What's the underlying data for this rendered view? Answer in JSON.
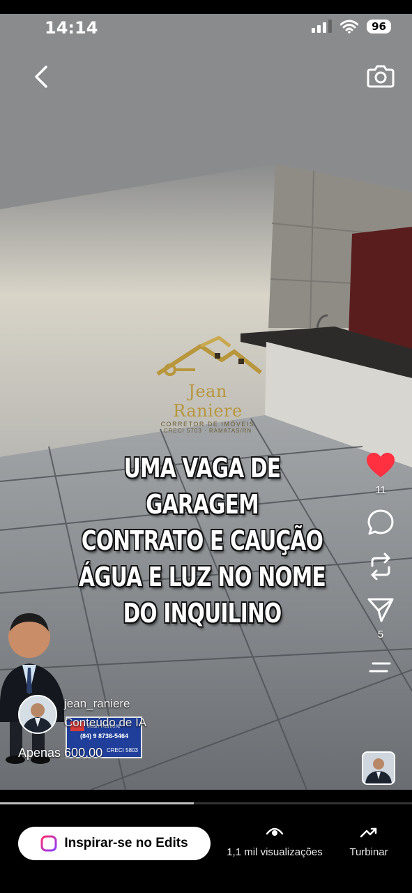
{
  "status_bar": {
    "time": "14:14",
    "battery": "96",
    "icons": [
      "signal-icon",
      "wifi-icon",
      "battery-icon"
    ]
  },
  "nav": {
    "icons": [
      "back-icon",
      "camera-icon"
    ]
  },
  "watermark": {
    "name": "Jean Raniere",
    "subtitle": "CORRETOR DE IMÓVEIS",
    "creci": "CRECI 5703 · RAMATAS/RN"
  },
  "caption": {
    "lines": [
      "UMA VAGA DE GARAGEM",
      "CONTRATO E CAUÇÃO",
      "ÁGUA E LUZ NO NOME",
      "DO INQUILINO"
    ]
  },
  "actions": {
    "likes": "11",
    "shares": "5",
    "icons": [
      "heart-icon",
      "comment-icon",
      "repost-icon",
      "send-icon",
      "more-icon"
    ],
    "accent_color": "#ff3040"
  },
  "author": {
    "username": "jean_raniere",
    "ai_label": "Conteúdo de IA",
    "price_text": "Apenas 600,00",
    "sign_lines": [
      "Jean Raniere",
      "(84) 9 8736-5464",
      "CRECI 5803"
    ]
  },
  "playback": {
    "progress": 0.47
  },
  "bottom_bar": {
    "edits_label": "Inspirar-se no Edits",
    "views_label": "1,1 mil visualizações",
    "boost_label": "Turbinar"
  }
}
